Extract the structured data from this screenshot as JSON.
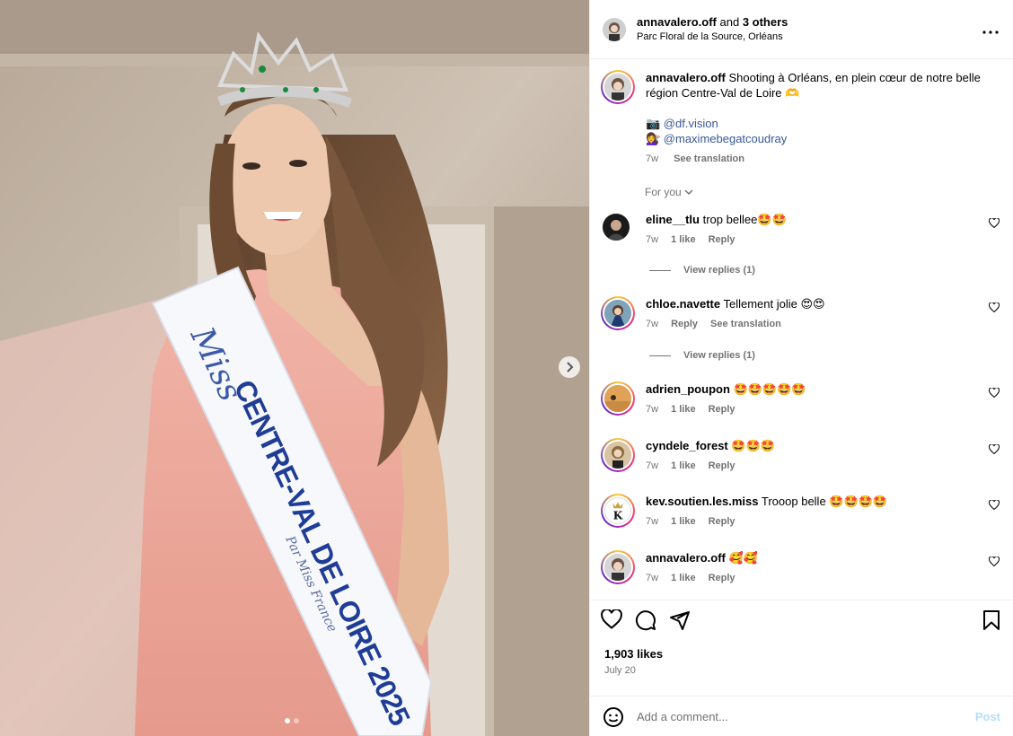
{
  "post": {
    "author": "annavalero.off",
    "coauthors": "3 others",
    "and_text": "and",
    "location": "Parc Floral de la Source, Orléans",
    "more_icon": "more-horizontal-icon"
  },
  "caption": {
    "username": "annavalero.off",
    "text": "Shooting à Orléans, en plein cœur de notre belle région Centre-Val de Loire 🫶",
    "credit1": "📷 @df.vision",
    "credit2": "💇‍♀️ @maximebegatcoudray",
    "time": "7w",
    "see_translation": "See translation"
  },
  "for_you": "For you",
  "comments": [
    {
      "user": "eline__tlu",
      "text": "trop bellee🤩🤩",
      "time": "7w",
      "likes": "1 like",
      "reply": "Reply",
      "view_replies": "View replies (1)"
    },
    {
      "user": "chloe.navette",
      "text": "Tellement jolie 😍😍",
      "time": "7w",
      "reply": "Reply",
      "see_translation": "See translation",
      "view_replies": "View replies (1)"
    },
    {
      "user": "adrien_poupon",
      "text": "🤩🤩🤩🤩🤩",
      "time": "7w",
      "likes": "1 like",
      "reply": "Reply"
    },
    {
      "user": "cyndele_forest",
      "text": "🤩🤩🤩",
      "time": "7w",
      "likes": "1 like",
      "reply": "Reply"
    },
    {
      "user": "kev.soutien.les.miss",
      "text": "Trooop belle 🤩🤩🤩🤩",
      "time": "7w",
      "likes": "1 like",
      "reply": "Reply"
    },
    {
      "user": "annavalero.off",
      "text": "🥰🥰",
      "time": "7w",
      "likes": "1 like",
      "reply": "Reply"
    }
  ],
  "stats": {
    "likes": "1,903 likes",
    "date": "July 20"
  },
  "add_comment": {
    "placeholder": "Add a comment...",
    "post_label": "Post"
  },
  "media": {
    "sash_text_1": "Miss",
    "sash_text_2": "CENTRE-VAL DE LOIRE 2025",
    "sash_text_3": "Par Miss France",
    "slide": 1,
    "slides": 2
  }
}
